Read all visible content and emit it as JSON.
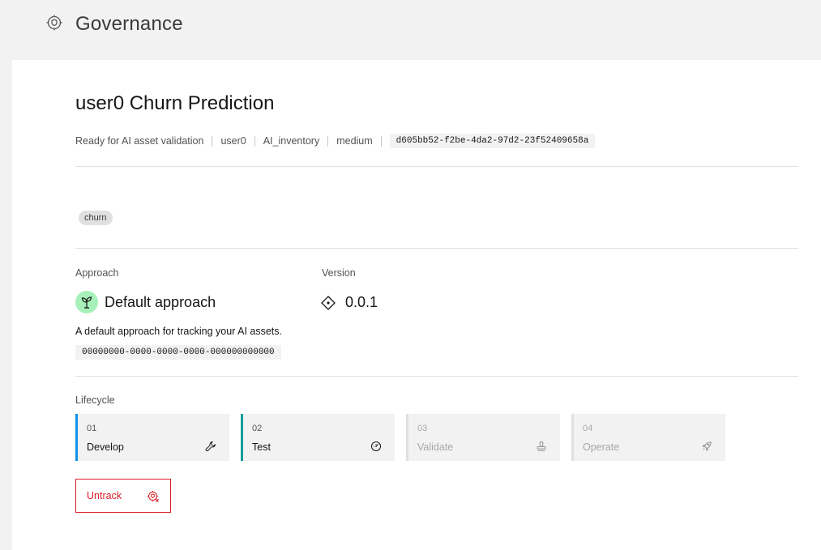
{
  "header": {
    "title": "Governance",
    "icon": "governance-icon"
  },
  "asset": {
    "title": "user0 Churn Prediction",
    "meta": [
      "Ready for AI asset validation",
      "user0",
      "AI_inventory",
      "medium"
    ],
    "id": "d605bb52-f2be-4da2-97d2-23f52409658a",
    "tags": [
      "churn"
    ]
  },
  "approach": {
    "label": "Approach",
    "name": "Default approach",
    "description": "A default approach for tracking your AI assets.",
    "id": "00000000-0000-0000-0000-000000000000",
    "icon": "sprout-icon"
  },
  "version": {
    "label": "Version",
    "value": "0.0.1",
    "icon": "version-diamond-icon"
  },
  "lifecycle": {
    "label": "Lifecycle",
    "stages": [
      {
        "num": "01",
        "name": "Develop",
        "icon": "wrench-icon",
        "color": "#1192e8",
        "state": "active"
      },
      {
        "num": "02",
        "name": "Test",
        "icon": "gauge-icon",
        "color": "#009d9a",
        "state": "active"
      },
      {
        "num": "03",
        "name": "Validate",
        "icon": "stamp-icon",
        "color": "#e0e0e0",
        "state": "disabled"
      },
      {
        "num": "04",
        "name": "Operate",
        "icon": "rocket-icon",
        "color": "#e0e0e0",
        "state": "disabled"
      }
    ]
  },
  "actions": {
    "untrack_label": "Untrack",
    "untrack_icon": "untrack-icon"
  },
  "colors": {
    "danger": "#da1e28",
    "approach_bg": "#a7f0ba"
  }
}
